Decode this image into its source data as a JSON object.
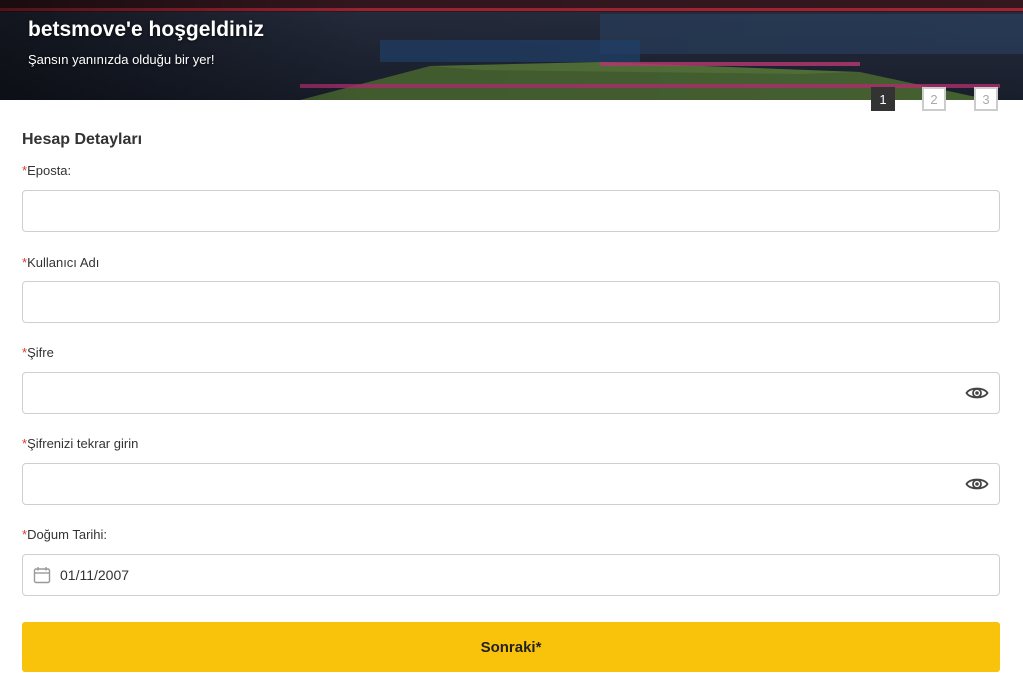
{
  "banner": {
    "title": "betsmove'e hoşgeldiniz",
    "subtitle": "Şansın yanınızda olduğu bir yer!"
  },
  "steps": [
    "1",
    "2",
    "3"
  ],
  "active_step": "1",
  "form": {
    "section_title": "Hesap Detayları",
    "required_mark": "*",
    "email": {
      "label": "Eposta:",
      "value": ""
    },
    "username": {
      "label": "Kullanıcı Adı",
      "value": ""
    },
    "password": {
      "label": "Şifre",
      "value": "",
      "icon": "eye-icon"
    },
    "password_confirm": {
      "label": "Şifrenizi tekrar girin",
      "value": "",
      "icon": "eye-icon"
    },
    "birth_date": {
      "label": "Doğum Tarihi:",
      "value": "01/11/2007",
      "icon": "calendar-icon"
    },
    "next_label": "Sonraki*"
  },
  "colors": {
    "accent": "#f9c20b",
    "required": "#e0382e",
    "step_active": "#333333"
  }
}
